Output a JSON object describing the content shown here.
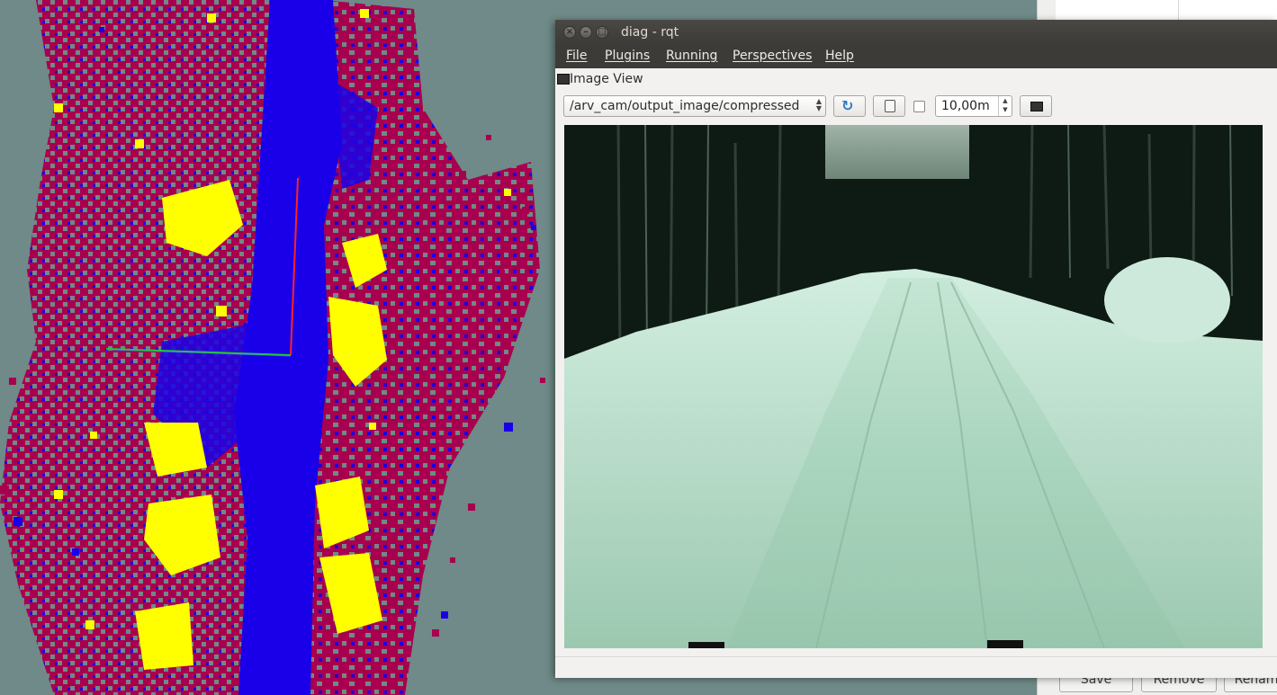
{
  "window": {
    "title": "diag - rqt",
    "menu": [
      "File",
      "Plugins",
      "Running",
      "Perspectives",
      "Help"
    ]
  },
  "plugin": {
    "title": "Image View",
    "topic": "/arv_cam/output_image/compressed",
    "duration_value": "10,00m",
    "rotate_checked": false
  },
  "background_panel": {
    "buttons": [
      "Save",
      "Remove",
      "Renam"
    ]
  },
  "icons": {
    "close": "close-icon",
    "minimize": "minimize-icon",
    "maximize": "maximize-icon",
    "refresh": "refresh-icon",
    "save_image": "save-image-icon",
    "smooth": "smooth-image-icon"
  },
  "colors": {
    "rviz_background": "#6f8a88",
    "map_free": "#1a00e8",
    "map_occupied": "#a8004e",
    "map_high": "#ffff00",
    "axis_x": "#ff2222",
    "axis_y": "#22cc22",
    "titlebar": "#3c3b37",
    "camera_tint": "#a8d8c0"
  }
}
